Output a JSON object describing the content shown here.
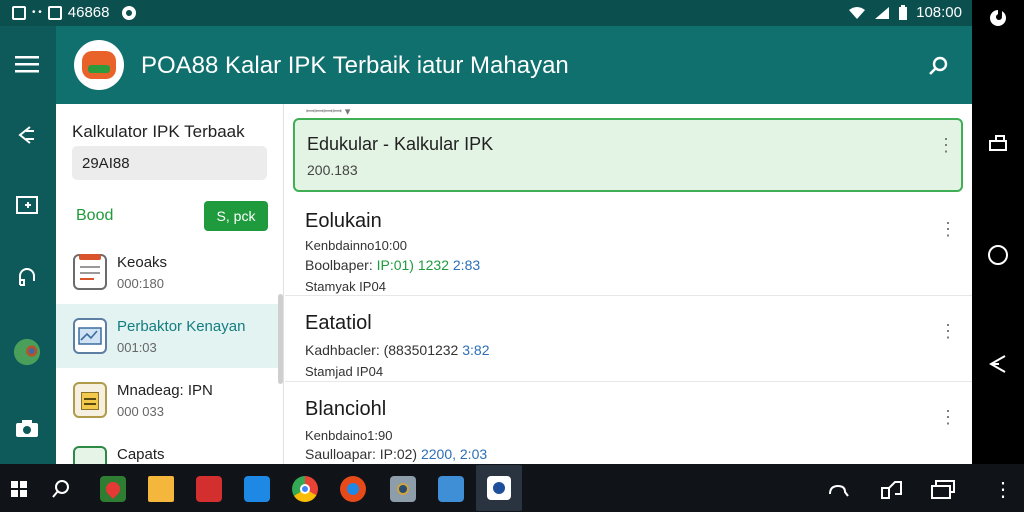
{
  "status_bar": {
    "left_text": "46868",
    "time": "108:00"
  },
  "app_bar": {
    "title": "POA88  Kalar IPK Terbaik iatur Mahayan"
  },
  "sidebar": {
    "heading": "Kalkulator IPK Terbaak",
    "input_value": "29AI88",
    "filter_label": "Bood",
    "green_button": "S, pck",
    "items": [
      {
        "label": "Keoaks",
        "sub": "000:180"
      },
      {
        "label": "Perbaktor Kenayan",
        "sub": "001:03"
      },
      {
        "label": "Mnadeag: IPN",
        "sub": "000 033"
      },
      {
        "label": "Capats",
        "sub": ""
      }
    ]
  },
  "main": {
    "crumb": "ꟷꟷꟷꟷ ▾",
    "selected": {
      "title": "Edukular - Kalkular IPK",
      "sub": "200.183"
    },
    "rows": [
      {
        "title": "Eolukain",
        "l1": "Kenbdainno10:00",
        "l2_prefix": "Boolbaper: ",
        "l2_green": "IP:01) 1232",
        "l2_blue": " 2:83",
        "l3": "Stamyak IP04"
      },
      {
        "title": "Eatatiol",
        "l1": "",
        "l2_prefix": "Kadhbacler: (883501232 ",
        "l2_green": "",
        "l2_blue": "3:82",
        "l3": "Stamjad IP04"
      },
      {
        "title": "Blanciohl",
        "l1": "Kenbdaino1:90",
        "l2_prefix": "Saulloapar: IP:02) ",
        "l2_green": "",
        "l2_blue": "2200, 2:03",
        "l3": ""
      }
    ]
  },
  "colors": {
    "teal": "#10706e",
    "green": "#1f9b3e",
    "blue": "#2c6fb5"
  }
}
